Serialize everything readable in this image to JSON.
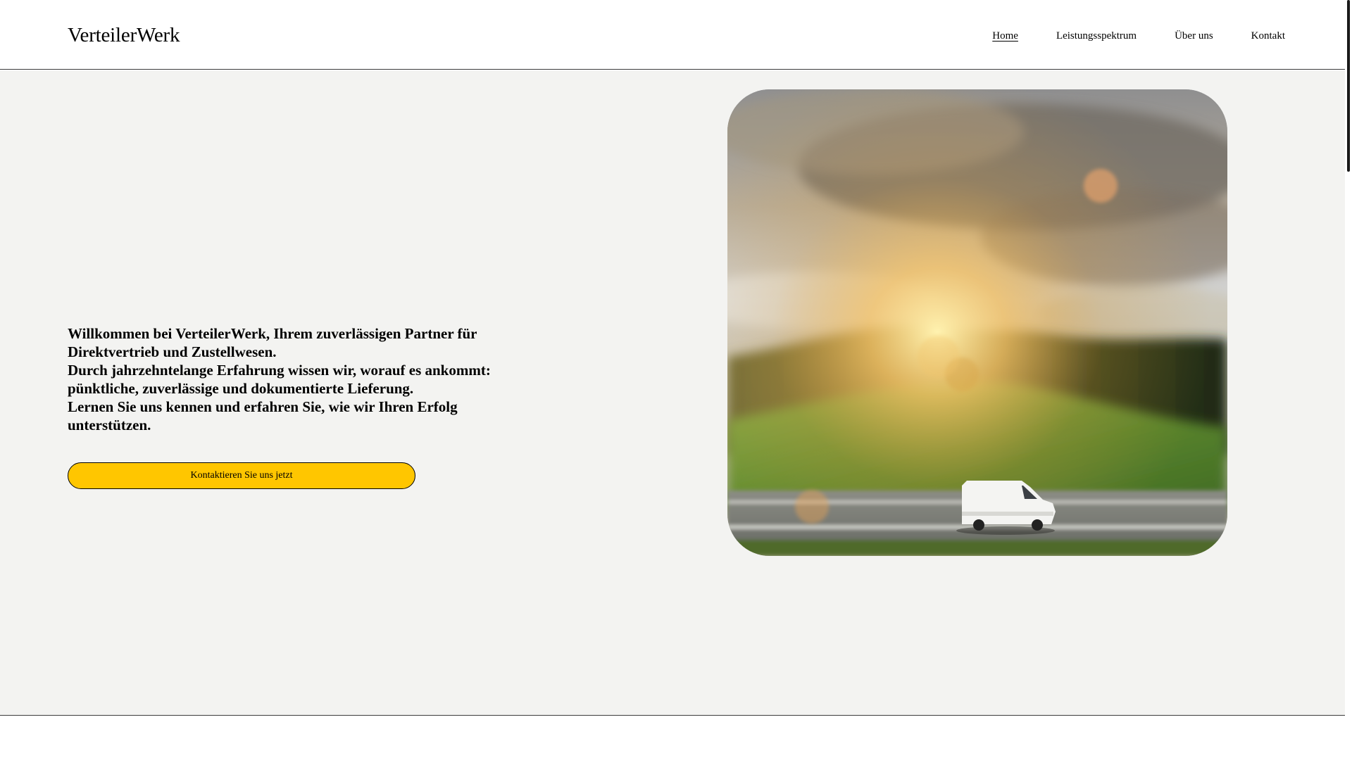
{
  "header": {
    "logo": "VerteilerWerk",
    "nav": [
      {
        "label": "Home",
        "active": true
      },
      {
        "label": "Leistungsspektrum",
        "active": false
      },
      {
        "label": "Über uns",
        "active": false
      },
      {
        "label": "Kontakt",
        "active": false
      }
    ]
  },
  "hero": {
    "lines": [
      "Willkommen bei VerteilerWerk, Ihrem zuverlässigen Partner für Direktvertrieb und Zustellwesen.",
      "Durch jahrzehntelange Erfahrung wissen wir, worauf es ankommt: pünktliche, zuverlässige und dokumentierte Lieferung.",
      "Lernen Sie uns kennen und erfahren Sie, wie wir Ihren Erfolg unterstützen."
    ],
    "cta_label": "Kontaktieren Sie uns jetzt",
    "cta_color": "#ffc600",
    "background_color": "#f3f3f1"
  },
  "image": {
    "subject": "white delivery van driving on a road at sunset with motion blur"
  }
}
